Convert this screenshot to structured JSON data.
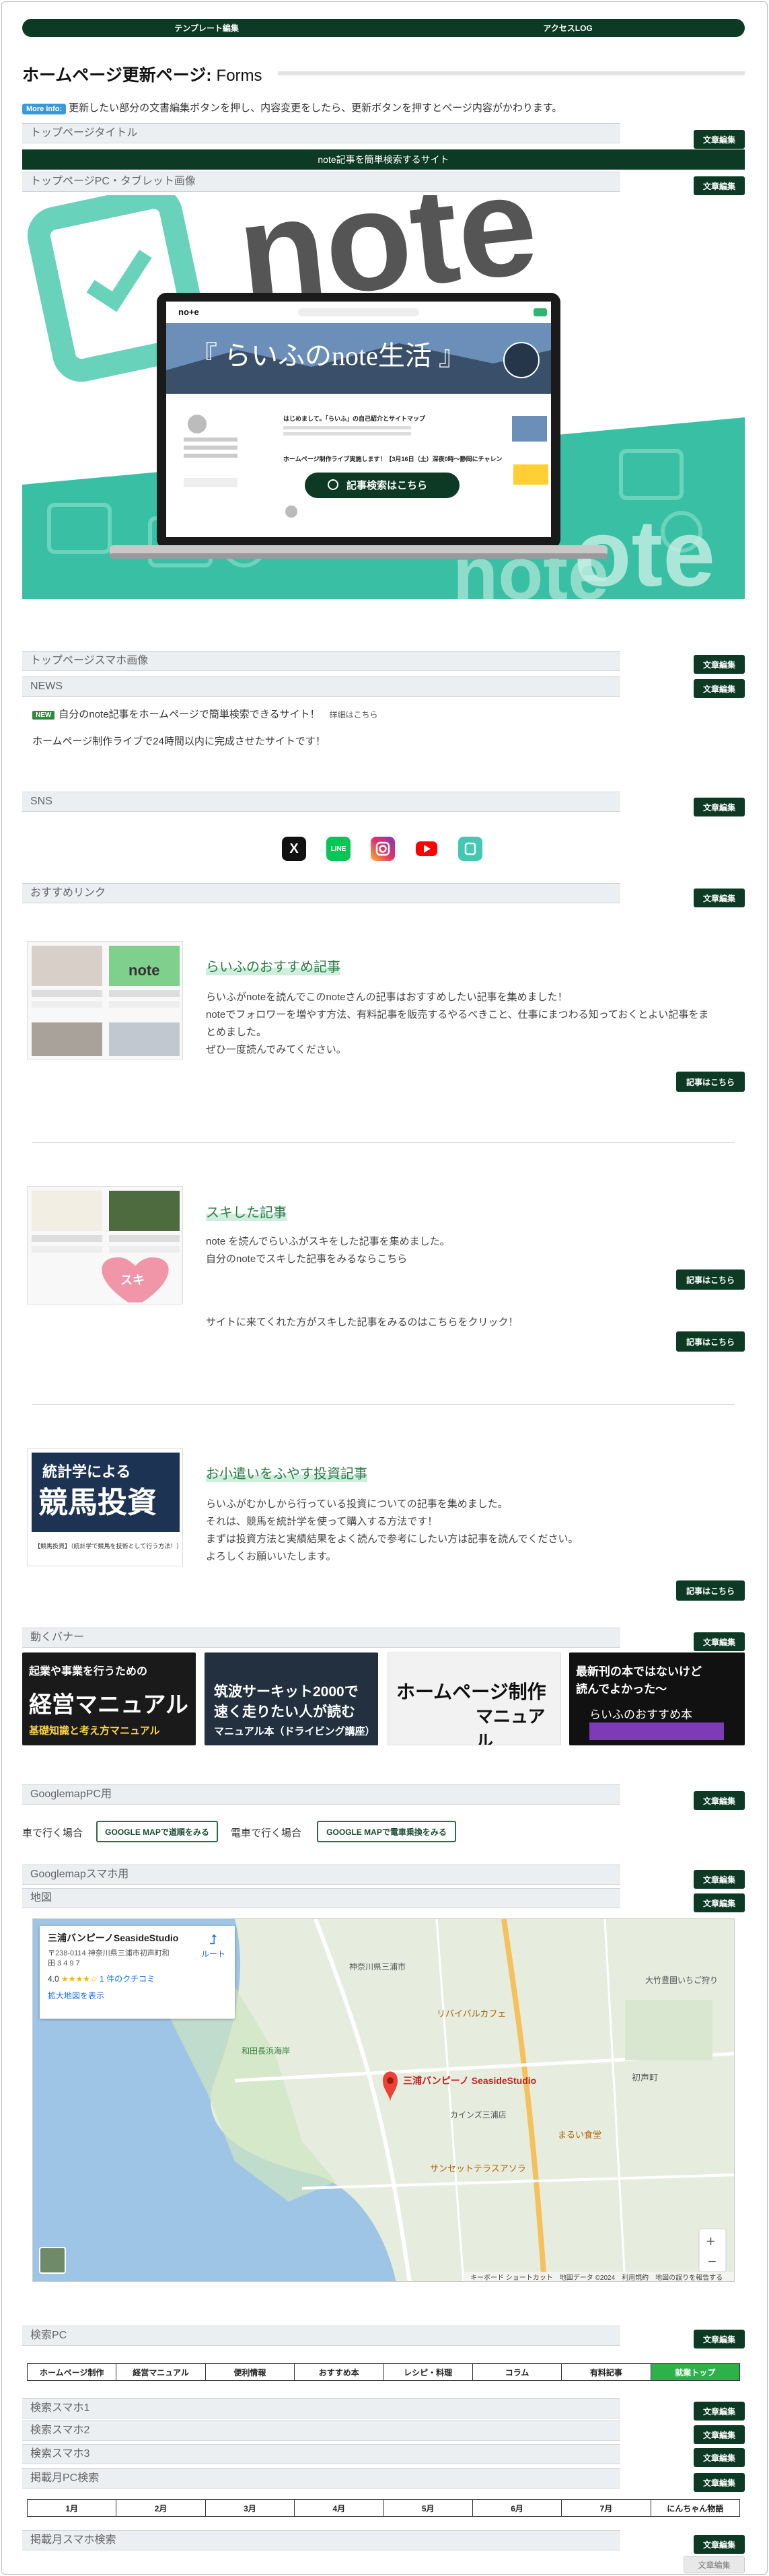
{
  "topnav": {
    "left": "テンプレート編集",
    "right": "アクセスLOG"
  },
  "page": {
    "title": "ホームページ更新ページ: ",
    "title_sub": "Forms",
    "info_badge": "More Info:",
    "info_text": "更新したい部分の文書編集ボタンを押し、内容変更をしたら、更新ボタンを押すとページ内容がかわります。"
  },
  "edit_label": "文章編集",
  "sections": {
    "top_title": "トップページタイトル",
    "top_title_value": "note記事を簡単検索するサイト",
    "top_pc": "トップページPC・タブレット画像",
    "top_sp": "トップページスマホ画像",
    "news": "NEWS",
    "sns": "SNS",
    "reco": "おすすめリンク",
    "banner": "動くバナー",
    "gmap_pc": "GooglemapPC用",
    "gmap_sp": "Googlemapスマホ用",
    "map": "地図",
    "search_pc": "検索PC",
    "search_sp1": "検索スマホ1",
    "search_sp2": "検索スマホ2",
    "search_sp3": "検索スマホ3",
    "month_pc": "掲載月PC検索",
    "month_sp": "掲載月スマホ検索"
  },
  "hero": {
    "bigword": "note",
    "site_title": "『 らいふのnote生活 』",
    "search_btn": "記事検索はこちら",
    "logo": "no+e",
    "post_title": "はじめまして。「らいふ」の自己紹介とサイトマップ",
    "post2": "ホームページ制作ライブ実施します！【3月16日（土）深夜0時～静岡にチャレン"
  },
  "news": {
    "new_badge": "NEW",
    "item1": "自分のnote記事をホームページで簡単検索できるサイト！",
    "item1_more": "詳細はこちら",
    "item2": "ホームページ制作ライブで24時間以内に完成させたサイトです！"
  },
  "sns": {
    "x": "X",
    "line": "LINE",
    "instagram": "Instagram",
    "youtube": "YouTube",
    "note": "note"
  },
  "reco": [
    {
      "title": "らいふのおすすめ記事",
      "text": [
        "らいふがnoteを読んでこのnoteさんの記事はおすすめしたい記事を集めました！",
        "noteでフォロワーを増やす方法、有料記事を販売するやるべきこと、仕事にまつわる知っておくとよい記事をま",
        "とめました。",
        "ぜひ一度読んでみてください。"
      ],
      "btn": "記事はこちら",
      "thumb_word": "note"
    },
    {
      "title": "スキした記事",
      "text": [
        "note を読んでらいふがスキをした記事を集めました。",
        "自分のnoteでスキした記事をみるならこちら"
      ],
      "text2": "サイトに来てくれた方がスキした記事をみるのはこちらをクリック！",
      "btn": "記事はこちら",
      "btn2": "記事はこちら",
      "thumb_word": "スキ"
    },
    {
      "title": "お小遣いをふやす投資記事",
      "text": [
        "らいふがむかしから行っている投資についての記事を集めました。",
        "それは、競馬を統計学を使って購入する方法です！",
        "まずは投資方法と実績結果をよく読んで参考にしたい方は記事を読んでください。",
        "よろしくお願いいたします。"
      ],
      "btn": "記事はこちら",
      "thumb_line1": "統計学による",
      "thumb_line2": "競馬投資",
      "thumb_caption": "【競馬投資】（統計学で競馬を技術として行う方法！）"
    }
  ],
  "banners": [
    {
      "line1": "起業や事業を行うための",
      "line2": "経営マニュアル",
      "line3": "基礎知識と考え方マニュアル"
    },
    {
      "line1": "筑波サーキット2000で",
      "line2": "速く走りたい人が読む",
      "line3": "マニュアル本（ドライビング講座）"
    },
    {
      "line1": "ホームページ制作",
      "line2": "マニュアル",
      "line3": ""
    },
    {
      "line1": "最新刊の本ではないけど",
      "line2": "読んでよかった～",
      "line3": "らいふのおすすめ本"
    }
  ],
  "gmap": {
    "car_label": "車で行く場合",
    "car_btn": "GOOGLE MAPで道順をみる",
    "train_label": "電車で行く場合",
    "train_btn": "GOOGLE MAPで電車乗換をみる"
  },
  "map": {
    "place": "三浦バンピーノSeasideStudio",
    "address": "〒238-0114 神奈川県三浦市初声町和田 3 4 9 7",
    "rating": "4.0",
    "reviews": "1 件のクチコミ",
    "enlarge": "拡大地図を表示",
    "route": "ルート",
    "pin_label": "三浦バンピーノ SeasideStudio",
    "footer": "キーボード ショートカット　地図データ ©2024　利用規約　地図の誤りを報告する",
    "zoom_in": "+",
    "zoom_out": "−",
    "labels": [
      "リバイバルカフェ",
      "サンセットテラスアソラ",
      "カインズ三浦店",
      "まるい食堂",
      "大竹豊園いちご狩り",
      "初声町",
      "和田長浜海岸",
      "神奈川県三浦市"
    ]
  },
  "tabs": [
    "ホームページ制作",
    "経営マニュアル",
    "便利情報",
    "おすすめ本",
    "レシピ・料理",
    "コラム",
    "有料記事",
    "就業トップ"
  ],
  "months": [
    "1月",
    "2月",
    "3月",
    "4月",
    "5月",
    "6月",
    "7月",
    "にんちゃん物語"
  ],
  "footer_btn": "文章編集"
}
